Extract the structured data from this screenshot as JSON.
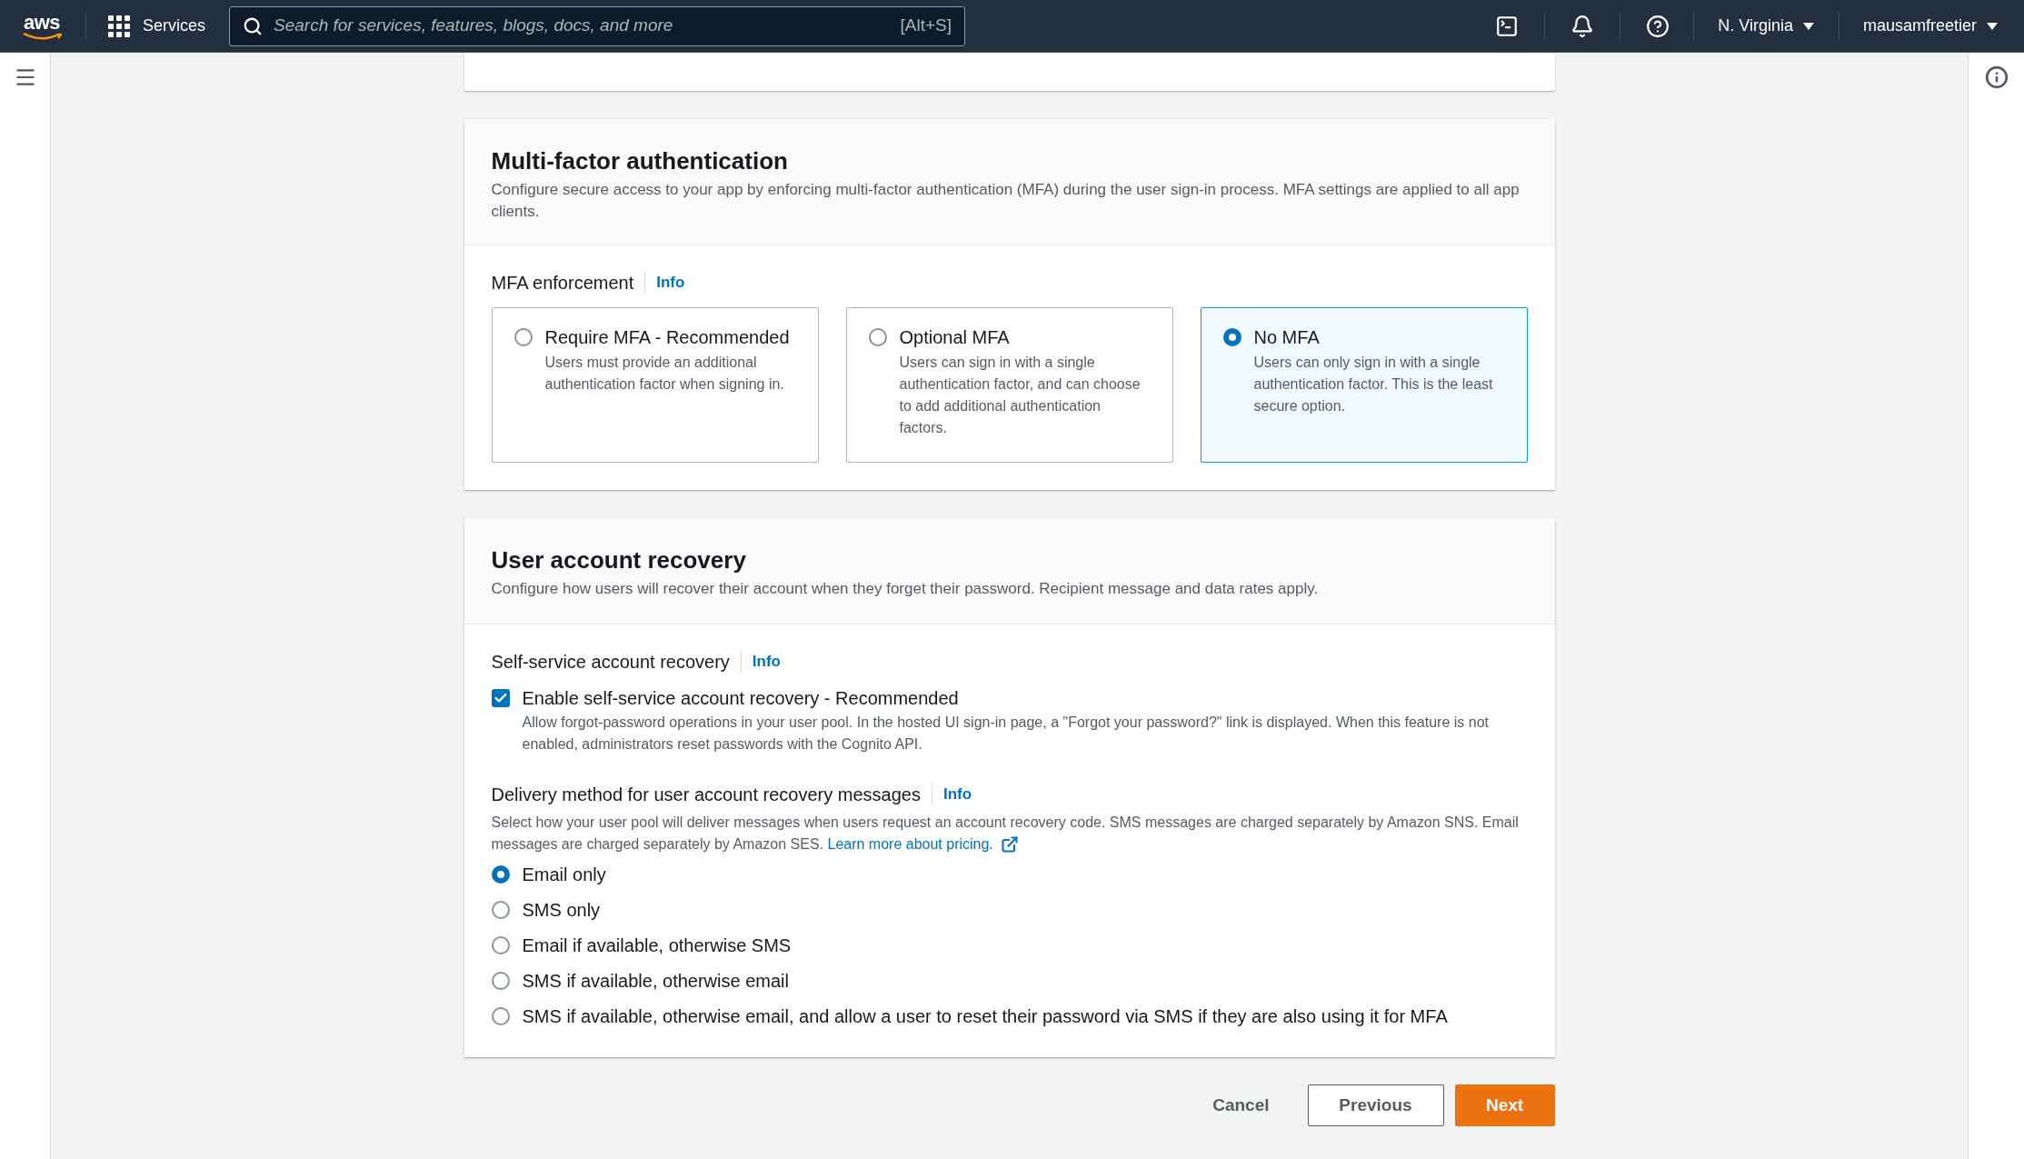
{
  "top_nav": {
    "logo": "aws",
    "services": "Services",
    "search": {
      "placeholder": "Search for services, features, blogs, docs, and more",
      "shortcut": "[Alt+S]"
    },
    "region": "N. Virginia",
    "account": "mausamfreetier"
  },
  "mfa": {
    "title": "Multi-factor authentication",
    "description": "Configure secure access to your app by enforcing multi-factor authentication (MFA) during the user sign-in process. MFA settings are applied to all app clients.",
    "field_label": "MFA enforcement",
    "info": "Info",
    "options": [
      {
        "label": "Require MFA - Recommended",
        "description": "Users must provide an additional authentication factor when signing in.",
        "selected": false
      },
      {
        "label": "Optional MFA",
        "description": "Users can sign in with a single authentication factor, and can choose to add additional authentication factors.",
        "selected": false
      },
      {
        "label": "No MFA",
        "description": "Users can only sign in with a single authentication factor. This is the least secure option.",
        "selected": true
      }
    ]
  },
  "recovery": {
    "title": "User account recovery",
    "description": "Configure how users will recover their account when they forget their password. Recipient message and data rates apply.",
    "self_service": {
      "label": "Self-service account recovery",
      "info": "Info",
      "checkbox": {
        "label": "Enable self-service account recovery - Recommended",
        "description": "Allow forgot-password operations in your user pool. In the hosted UI sign-in page, a \"Forgot your password?\" link is displayed. When this feature is not enabled, administrators reset passwords with the Cognito API.",
        "checked": true
      }
    },
    "delivery": {
      "label": "Delivery method for user account recovery messages",
      "info": "Info",
      "description": "Select how your user pool will deliver messages when users request an account recovery code. SMS messages are charged separately by Amazon SNS. Email messages are charged separately by Amazon SES.",
      "link": "Learn more about pricing.",
      "options": [
        {
          "label": "Email only",
          "selected": true
        },
        {
          "label": "SMS only",
          "selected": false
        },
        {
          "label": "Email if available, otherwise SMS",
          "selected": false
        },
        {
          "label": "SMS if available, otherwise email",
          "selected": false
        },
        {
          "label": "SMS if available, otherwise email, and allow a user to reset their password via SMS if they are also using it for MFA",
          "selected": false
        }
      ]
    }
  },
  "actions": {
    "cancel": "Cancel",
    "previous": "Previous",
    "next": "Next"
  }
}
